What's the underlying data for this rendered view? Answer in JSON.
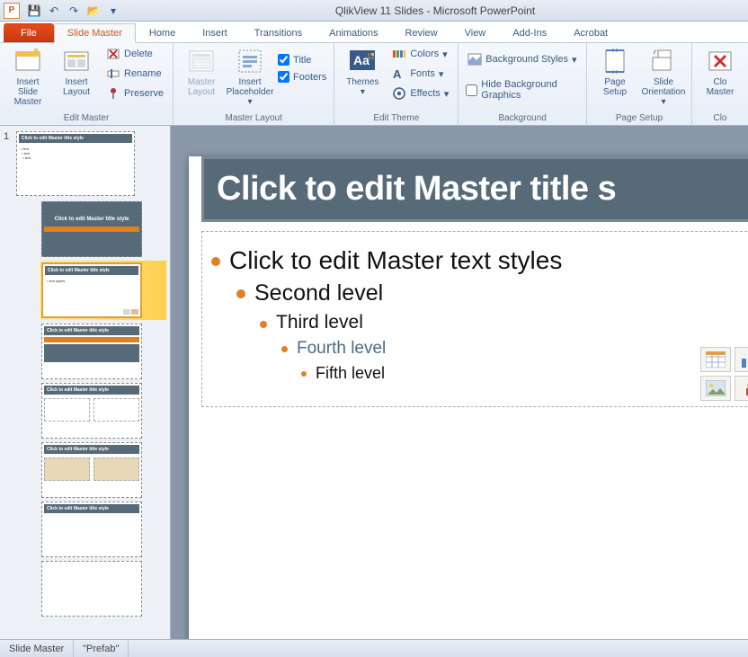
{
  "titlebar": {
    "title": "QlikView 11 Slides  -  Microsoft PowerPoint",
    "app_letter": "P"
  },
  "qat": {
    "save": "💾",
    "undo": "↶",
    "redo": "↷",
    "open": "📂"
  },
  "tabs": {
    "file": "File",
    "slide_master": "Slide Master",
    "home": "Home",
    "insert": "Insert",
    "transitions": "Transitions",
    "animations": "Animations",
    "review": "Review",
    "view": "View",
    "addins": "Add-Ins",
    "acrobat": "Acrobat"
  },
  "ribbon": {
    "edit_master": {
      "insert_slide_master": "Insert Slide\nMaster",
      "insert_layout": "Insert\nLayout",
      "delete": "Delete",
      "rename": "Rename",
      "preserve": "Preserve",
      "label": "Edit Master"
    },
    "master_layout": {
      "master_layout": "Master\nLayout",
      "insert_placeholder": "Insert\nPlaceholder",
      "title": "Title",
      "footers": "Footers",
      "label": "Master Layout"
    },
    "edit_theme": {
      "themes": "Themes",
      "colors": "Colors",
      "fonts": "Fonts",
      "effects": "Effects",
      "label": "Edit Theme"
    },
    "background": {
      "bg_styles": "Background Styles",
      "hide_bg": "Hide Background Graphics",
      "label": "Background"
    },
    "page_setup": {
      "page_setup": "Page\nSetup",
      "orientation": "Slide\nOrientation",
      "label": "Page Setup"
    },
    "close": {
      "close_master": "Clo\nMaster",
      "label": "Clo"
    }
  },
  "thumbs": {
    "master_num": "1",
    "title_placeholder": "Click to edit Master title style"
  },
  "slide": {
    "title": "Click to edit Master title s",
    "l1": "Click to edit Master text styles",
    "l2": "Second level",
    "l3": "Third level",
    "l4": "Fourth level",
    "l5": "Fifth level"
  },
  "status": {
    "mode": "Slide Master",
    "theme": "\"Prefab\""
  }
}
